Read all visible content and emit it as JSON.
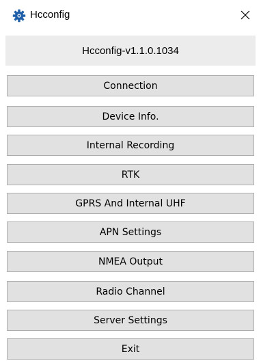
{
  "window": {
    "title": "Hcconfig",
    "icon": "gear-icon",
    "close_icon": "close-icon"
  },
  "header": {
    "version": "Hcconfig-v1.1.0.1034"
  },
  "menu": {
    "buttons": [
      {
        "label": "Connection"
      },
      {
        "label": "Device Info."
      },
      {
        "label": "Internal Recording"
      },
      {
        "label": "RTK"
      },
      {
        "label": "GPRS And Internal UHF"
      },
      {
        "label": "APN Settings"
      },
      {
        "label": "NMEA Output"
      },
      {
        "label": "Radio Channel"
      },
      {
        "label": "Server Settings"
      },
      {
        "label": "Exit"
      }
    ]
  },
  "colors": {
    "icon_blue": "#1f5fa8",
    "button_face": "#e1e1e1",
    "button_border": "#adadad",
    "header_bg": "#ececec"
  }
}
